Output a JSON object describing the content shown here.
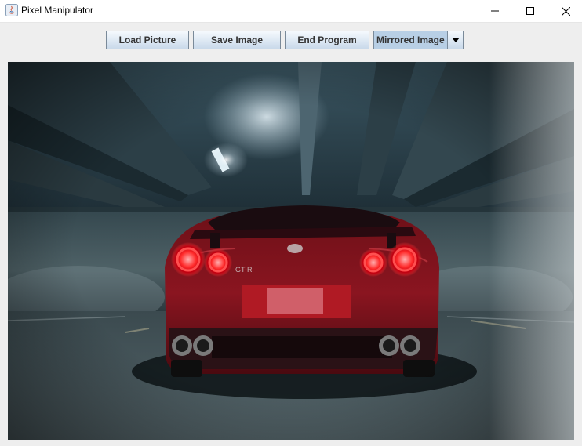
{
  "window": {
    "title": "Pixel Manipulator",
    "controls": {
      "minimize": "minimize-icon",
      "maximize": "maximize-icon",
      "close": "close-icon"
    }
  },
  "toolbar": {
    "load_label": "Load Picture",
    "save_label": "Save Image",
    "end_label": "End Program",
    "filter_select": {
      "selected": "Mirrored Image"
    }
  },
  "image": {
    "subject": "red sports car in underground parking garage, rear view with illuminated round tail lights"
  },
  "colors": {
    "button_gradient_top": "#f5f9fd",
    "button_gradient_bottom": "#c9d9ea",
    "button_border": "#7a8a99",
    "combo_selected_bg": "#b8cfe5",
    "window_bg": "#eeeeee"
  }
}
